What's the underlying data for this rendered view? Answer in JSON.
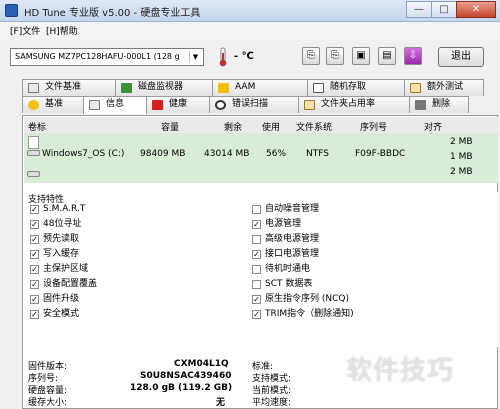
{
  "window": {
    "title": "HD Tune 专业版 v5.00 - 硬盘专业工具",
    "min_glyph": "—",
    "max_glyph": "□",
    "close_glyph": "✕"
  },
  "menu": {
    "file": "[F]文件",
    "help": "[H]帮助"
  },
  "toolbar": {
    "drive": "SAMSUNG MZ7PC128HAFU-000L1 (128 g",
    "temperature": "- ℃",
    "exit_label": "退出"
  },
  "tabs_top": [
    "文件基准",
    "磁盘监视器",
    "AAM",
    "随机存取",
    "额外测试"
  ],
  "tabs_bottom": [
    "基准",
    "信息",
    "健康",
    "错误扫描",
    "文件夹占用率",
    "删除"
  ],
  "volumes": {
    "headers": {
      "label": "卷标",
      "capacity": "容量",
      "free": "剩余",
      "used": "使用",
      "fs": "文件系统",
      "serial": "序列号",
      "align": "对齐"
    },
    "row": {
      "label": "Windows7_OS (C:)",
      "capacity": "98409 MB",
      "free": "43014 MB",
      "used": "56%",
      "fs": "NTFS",
      "serial": "F09F-BBDC"
    },
    "align_values": [
      "2 MB",
      "1 MB",
      "2 MB"
    ]
  },
  "features": {
    "title": "支持特性",
    "left": [
      {
        "label": "S.M.A.R.T",
        "checked": true
      },
      {
        "label": "48位寻址",
        "checked": true
      },
      {
        "label": "预先读取",
        "checked": true
      },
      {
        "label": "写入缓存",
        "checked": true
      },
      {
        "label": "主保护区域",
        "checked": true
      },
      {
        "label": "设备配置覆盖",
        "checked": true
      },
      {
        "label": "固件升级",
        "checked": true
      },
      {
        "label": "安全模式",
        "checked": true
      }
    ],
    "right": [
      {
        "label": "自动噪音管理",
        "checked": false
      },
      {
        "label": "电源管理",
        "checked": true
      },
      {
        "label": "高级电源管理",
        "checked": false
      },
      {
        "label": "接口电源管理",
        "checked": true
      },
      {
        "label": "待机时通电",
        "checked": false
      },
      {
        "label": "SCT 数据表",
        "checked": false
      },
      {
        "label": "原生指令序列 (NCQ)",
        "checked": true
      },
      {
        "label": "TRIM指令（删除通知)",
        "checked": true
      }
    ]
  },
  "info": {
    "firmware_label": "固件版本:",
    "firmware": "CXM04L1Q",
    "serial_label": "序列号:",
    "serial": "S0U8NSAC439460",
    "capacity_label": "硬盘容量:",
    "capacity": "128.0 gB (119.2 GB)",
    "buffer_label": "缓存大小:",
    "buffer": "无",
    "standard_label": "标准:",
    "mode_label": "支持模式:",
    "current_label": "当前模式:",
    "speed_label": "平均速度:"
  },
  "watermark": "软件技巧"
}
